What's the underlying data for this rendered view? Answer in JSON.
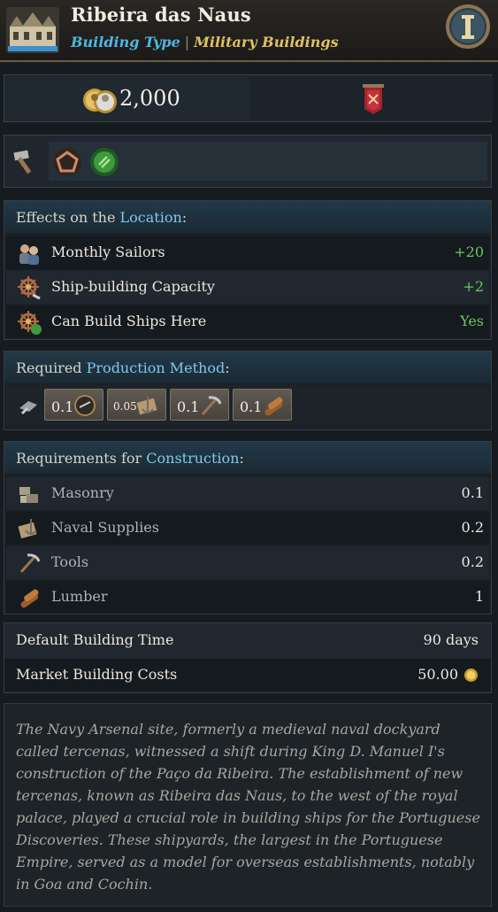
{
  "header": {
    "title": "Ribeira das Naus",
    "type_label": "Building Type",
    "separator": "|",
    "category": "Military Buildings",
    "icon": "building-icon",
    "info_icon": "info-i-icon"
  },
  "cost": {
    "value": "2,000",
    "icon": "gold-coins-icon",
    "banner_icon": "banner-icon"
  },
  "traits": [
    {
      "icon": "hammer-icon"
    },
    {
      "icon": "pentagon-icon"
    },
    {
      "icon": "green-check-icon"
    }
  ],
  "effects": {
    "title_prefix": "Effects on the",
    "title_highlight": "Location",
    "title_suffix": ":",
    "rows": [
      {
        "label": "Monthly Sailors",
        "value": "+20",
        "icon": "sailors-icon"
      },
      {
        "label": "Ship-building Capacity",
        "value": "+2",
        "icon": "ship-wheel-icon"
      },
      {
        "label": "Can Build Ships Here",
        "value": "Yes",
        "icon": "ship-wheel-check-icon"
      }
    ]
  },
  "production": {
    "title_prefix": "Required",
    "title_highlight": "Production Method",
    "title_suffix": ":",
    "method_icon": "production-method-icon",
    "inputs": [
      {
        "amount": "0.1",
        "icon": "compass-icon"
      },
      {
        "amount": "0.05",
        "icon": "naval-map-icon"
      },
      {
        "amount": "0.1",
        "icon": "tools-icon"
      },
      {
        "amount": "0.1",
        "icon": "lumber-icon"
      }
    ]
  },
  "requirements": {
    "title_prefix": "Requirements for",
    "title_highlight": "Construction",
    "title_suffix": ":",
    "rows": [
      {
        "label": "Masonry",
        "value": "0.1",
        "icon": "masonry-icon"
      },
      {
        "label": "Naval Supplies",
        "value": "0.2",
        "icon": "naval-supplies-icon"
      },
      {
        "label": "Tools",
        "value": "0.2",
        "icon": "tools-icon"
      },
      {
        "label": "Lumber",
        "value": "1",
        "icon": "lumber-icon"
      }
    ]
  },
  "summary": {
    "build_time_label": "Default Building Time",
    "build_time_value": "90 days",
    "market_cost_label": "Market Building Costs",
    "market_cost_value": "50.00",
    "market_cost_icon": "coin-icon"
  },
  "description": "The Navy Arsenal site, formerly a medieval naval dockyard called tercenas, witnessed a shift during King D. Manuel I's construction of the Paço da Ribeira. The establishment of new tercenas, known as Ribeira das Naus, to the west of the royal palace, played a crucial role in building ships for the Portuguese Discoveries. These shipyards, the largest in the Portuguese Empire, served as a model for overseas establishments, notably in Goa and Cochin."
}
